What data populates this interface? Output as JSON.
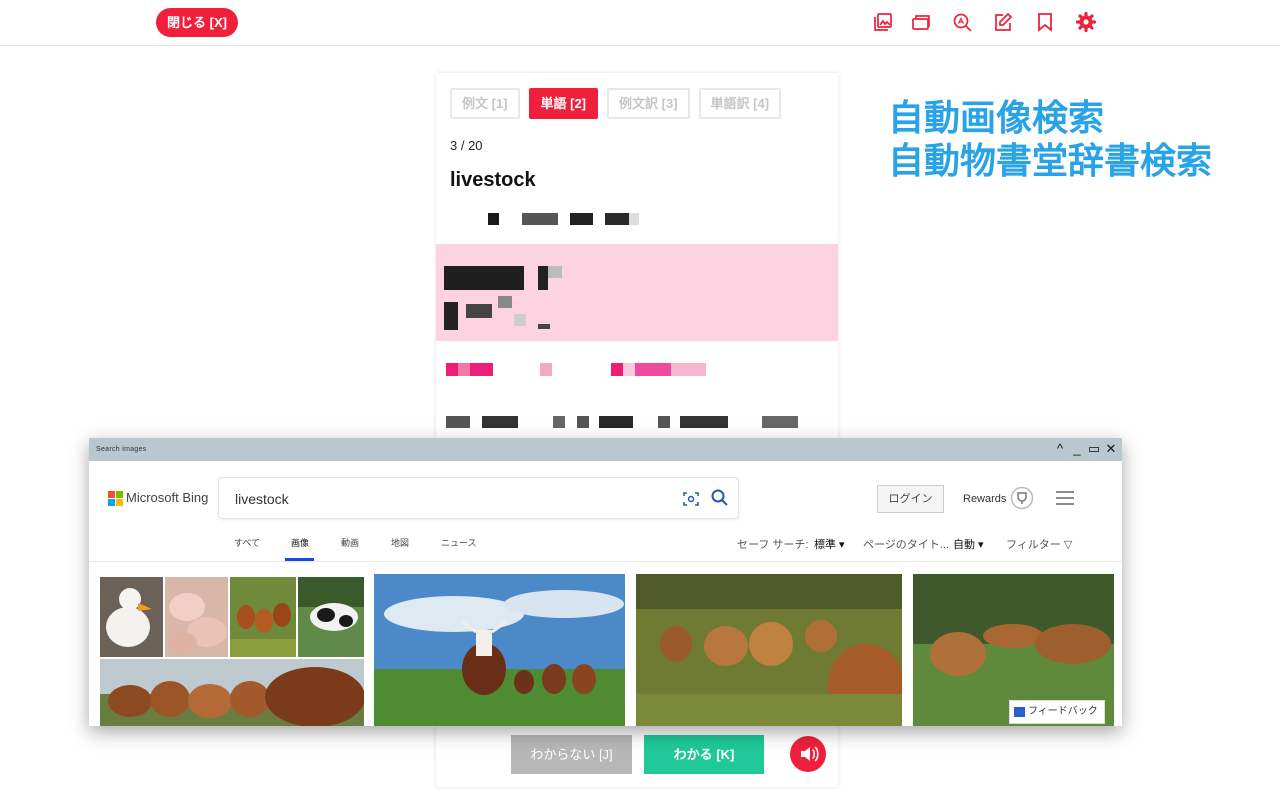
{
  "topbar": {
    "close_label": "閉じる [X]",
    "icons": [
      "gallery-icon",
      "card-icon",
      "zoom-search-icon",
      "edit-icon",
      "bookmark-icon",
      "gear-icon"
    ],
    "icon_color": "#f0203c"
  },
  "card": {
    "tabs": [
      {
        "label": "例文 [1]",
        "active": false
      },
      {
        "label": "単語 [2]",
        "active": true
      },
      {
        "label": "例文訳 [3]",
        "active": false
      },
      {
        "label": "単語訳 [4]",
        "active": false
      }
    ],
    "progress": "3 / 20",
    "word": "livestock",
    "unknown_label": "わからない [J]",
    "know_label": "わかる [K]",
    "highlight_color": "#fdd2e1",
    "accent_color": "#f0203c",
    "know_color": "#20c997"
  },
  "promo": {
    "line1": "自動画像検索",
    "line2": "自動物書堂辞書検索",
    "color": "#29a3e8"
  },
  "bing": {
    "window_title": "Search images",
    "logo_text": "Microsoft Bing",
    "query": "livestock",
    "login_label": "ログイン",
    "rewards_label": "Rewards",
    "nav": [
      "すべて",
      "画像",
      "動画",
      "地図",
      "ニュース"
    ],
    "active_nav": "画像",
    "safe_search_label": "セーフ サーチ:",
    "safe_search_value": "標準",
    "page_title_label": "ページのタイト...",
    "page_title_value": "自動",
    "filter_label": "フィルター",
    "feedback_label": "フィードバック"
  }
}
